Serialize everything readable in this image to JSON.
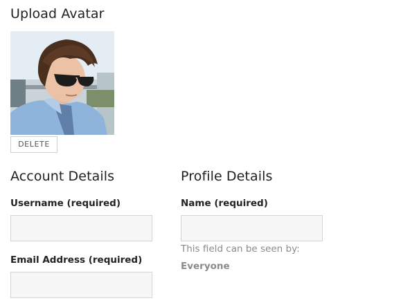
{
  "avatar_section": {
    "title": "Upload Avatar",
    "delete_label": "DELETE"
  },
  "account_details": {
    "title": "Account Details",
    "username_label": "Username (required)",
    "username_value": "",
    "email_label": "Email Address (required)",
    "email_value": ""
  },
  "profile_details": {
    "title": "Profile Details",
    "name_label": "Name (required)",
    "name_value": "",
    "visibility_prefix": "This field can be seen by:",
    "visibility_value": "Everyone"
  },
  "colors": {
    "input_background": "#f7f7f7",
    "input_border": "#d4d4d4",
    "muted_text": "#8a8a8a"
  }
}
